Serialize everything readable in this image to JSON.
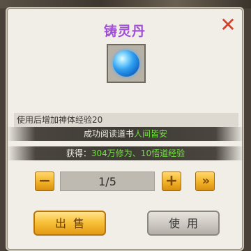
{
  "dialog": {
    "title": "铸灵丹",
    "close_icon": "close-icon",
    "item_icon": "blue-pill-icon",
    "description": "使用后增加神体经验20",
    "banner1": {
      "prefix": "成功阅读道书",
      "highlight": "人间皆安"
    },
    "banner2": {
      "prefix": "获得：",
      "highlight": "304万修为、10悟道经验"
    },
    "quantity": "1/5",
    "minus_label": "−",
    "plus_label": "+",
    "max_label": "»",
    "sell_label": "出售",
    "use_label": "使用"
  },
  "colors": {
    "title": "#a04ed8",
    "highlight": "#6fe23a",
    "gold_button": "#f2b226",
    "close": "#d4412c"
  }
}
